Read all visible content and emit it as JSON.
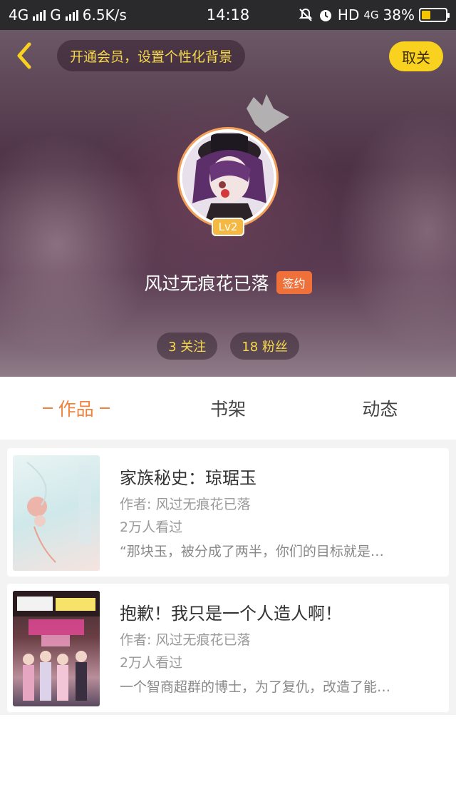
{
  "status_bar": {
    "network1": "4G",
    "network2": "G",
    "speed": "6.5K/s",
    "time": "14:18",
    "hd_label": "HD",
    "network3": "4G",
    "battery_percent": "38%",
    "battery_level": 0.38,
    "icons": [
      "signal-bars",
      "mute-bell-icon",
      "alarm-icon",
      "battery-icon"
    ]
  },
  "header": {
    "back_icon": "chevron-left-icon",
    "vip_prompt": "开通会员，设置个性化背景",
    "close_label": "取关",
    "accent": "#f9d21f",
    "level": "Lv2",
    "username": "风过无痕花已落",
    "signed_badge": "签约",
    "following": "3 关注",
    "followers": "18 粉丝"
  },
  "tabs": [
    {
      "label": "作品",
      "active": true
    },
    {
      "label": "书架",
      "active": false
    },
    {
      "label": "动态",
      "active": false
    }
  ],
  "tab_active_color": "#f0823d",
  "books": [
    {
      "title": "家族秘史：琼琚玉",
      "author": "作者: 风过无痕花已落",
      "views": "2万人看过",
      "excerpt": "“那块玉，被分成了两半，你们的目标就是…"
    },
    {
      "title": "抱歉！我只是一个人造人啊！",
      "author": "作者: 风过无痕花已落",
      "views": "2万人看过",
      "excerpt": "一个智商超群的博士，为了复仇，改造了能…"
    }
  ]
}
